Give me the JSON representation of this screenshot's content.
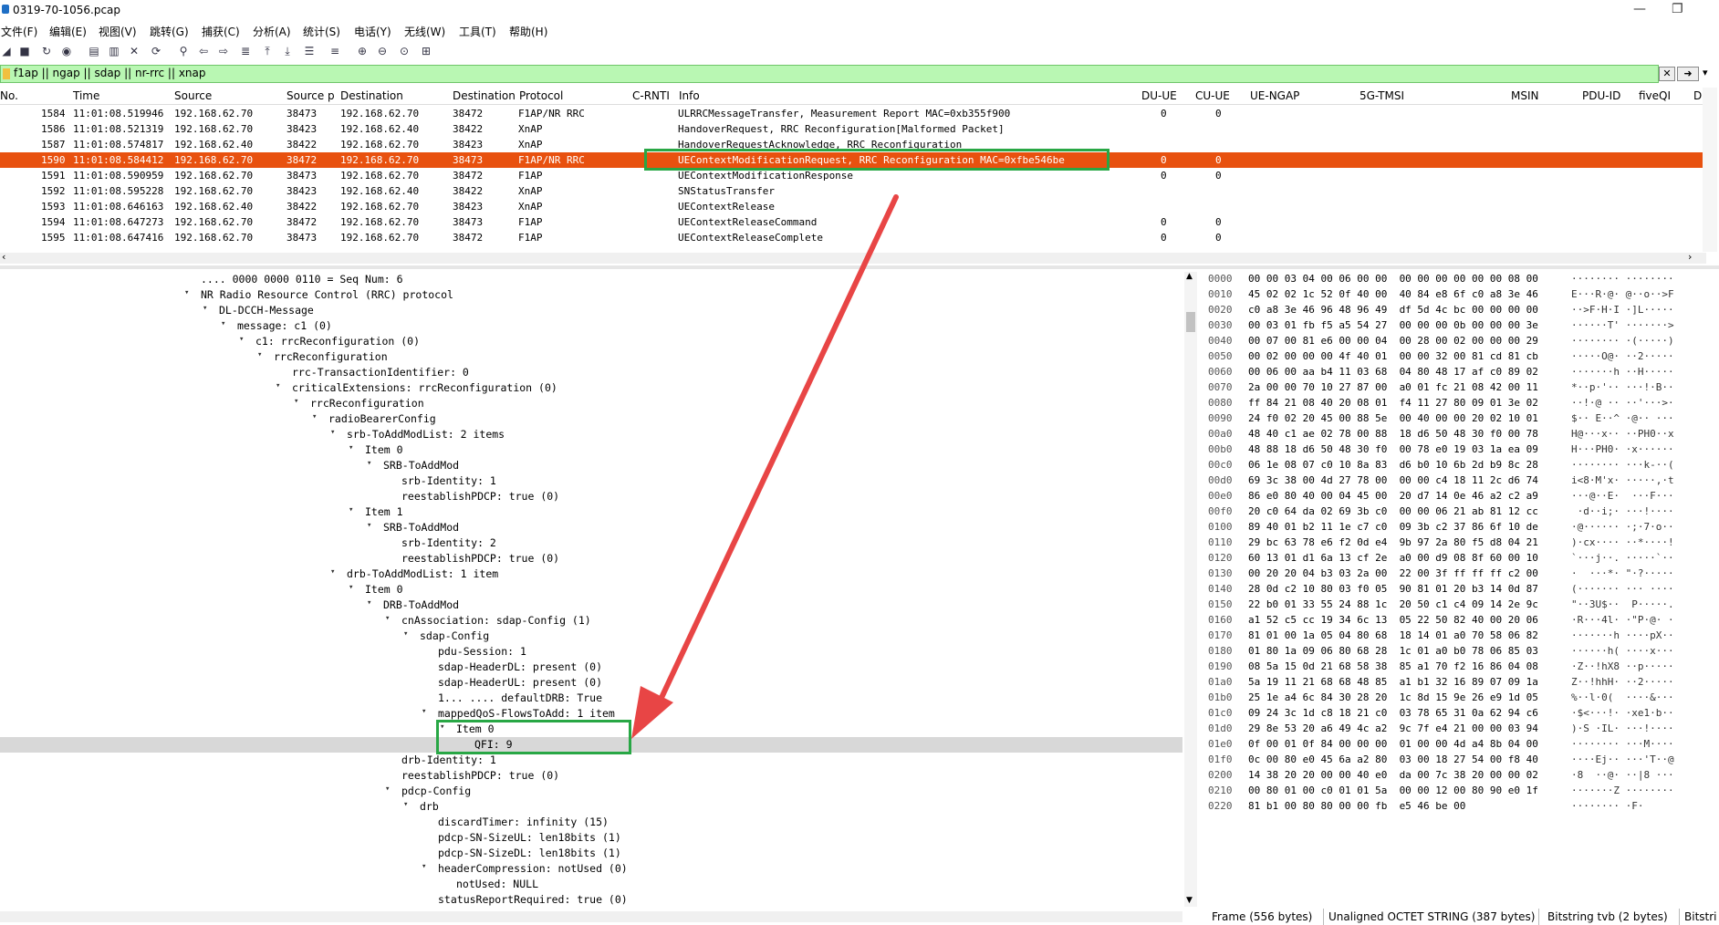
{
  "window": {
    "title": "0319-70-1056.pcap"
  },
  "menu": [
    "文件(F)",
    "编辑(E)",
    "视图(V)",
    "跳转(G)",
    "捕获(C)",
    "分析(A)",
    "统计(S)",
    "电话(Y)",
    "无线(W)",
    "工具(T)",
    "帮助(H)"
  ],
  "filter": {
    "value": "f1ap || ngap || sdap || nr-rrc || xnap"
  },
  "columns": [
    "No.",
    "Time",
    "Source",
    "Source p",
    "Destination",
    "Destination",
    "Protocol",
    "C-RNTI",
    "Info",
    "DU-UE",
    "CU-UE",
    "UE-NGAP",
    "5G-TMSI",
    "MSIN",
    "PDU-ID",
    "fiveQI",
    "D"
  ],
  "packets": [
    {
      "no": "1584",
      "time": "11:01:08.519946",
      "src": "192.168.62.70",
      "sport": "38473",
      "dst": "192.168.62.70",
      "dport": "38472",
      "proto": "F1AP/NR RRC",
      "info": "ULRRCMessageTransfer, Measurement Report MAC=0xb355f900",
      "du": "0",
      "cu": "0"
    },
    {
      "no": "1586",
      "time": "11:01:08.521319",
      "src": "192.168.62.70",
      "sport": "38423",
      "dst": "192.168.62.40",
      "dport": "38422",
      "proto": "XnAP",
      "info": "HandoverRequest, RRC Reconfiguration[Malformed Packet]",
      "du": "",
      "cu": ""
    },
    {
      "no": "1587",
      "time": "11:01:08.574817",
      "src": "192.168.62.40",
      "sport": "38422",
      "dst": "192.168.62.70",
      "dport": "38423",
      "proto": "XnAP",
      "info": "HandoverRequestAcknowledge, RRC Reconfiguration",
      "du": "",
      "cu": ""
    },
    {
      "no": "1590",
      "time": "11:01:08.584412",
      "src": "192.168.62.70",
      "sport": "38472",
      "dst": "192.168.62.70",
      "dport": "38473",
      "proto": "F1AP/NR RRC",
      "info": "UEContextModificationRequest, RRC Reconfiguration MAC=0xfbe546be",
      "du": "0",
      "cu": "0"
    },
    {
      "no": "1591",
      "time": "11:01:08.590959",
      "src": "192.168.62.70",
      "sport": "38473",
      "dst": "192.168.62.70",
      "dport": "38472",
      "proto": "F1AP",
      "info": "UEContextModificationResponse",
      "du": "0",
      "cu": "0"
    },
    {
      "no": "1592",
      "time": "11:01:08.595228",
      "src": "192.168.62.70",
      "sport": "38423",
      "dst": "192.168.62.40",
      "dport": "38422",
      "proto": "XnAP",
      "info": "SNStatusTransfer",
      "du": "",
      "cu": ""
    },
    {
      "no": "1593",
      "time": "11:01:08.646163",
      "src": "192.168.62.40",
      "sport": "38422",
      "dst": "192.168.62.70",
      "dport": "38423",
      "proto": "XnAP",
      "info": "UEContextRelease",
      "du": "",
      "cu": ""
    },
    {
      "no": "1594",
      "time": "11:01:08.647273",
      "src": "192.168.62.70",
      "sport": "38472",
      "dst": "192.168.62.70",
      "dport": "38473",
      "proto": "F1AP",
      "info": "UEContextReleaseCommand",
      "du": "0",
      "cu": "0"
    },
    {
      "no": "1595",
      "time": "11:01:08.647416",
      "src": "192.168.62.70",
      "sport": "38473",
      "dst": "192.168.62.70",
      "dport": "38472",
      "proto": "F1AP",
      "info": "UEContextReleaseComplete",
      "du": "0",
      "cu": "0"
    }
  ],
  "tree": [
    {
      "t": ".... 0000 0000 0110 = Seq Num: 6",
      "d": 11,
      "a": ""
    },
    {
      "t": "NR Radio Resource Control (RRC) protocol",
      "d": 11,
      "a": "v"
    },
    {
      "t": "DL-DCCH-Message",
      "d": 12,
      "a": "v"
    },
    {
      "t": "message: c1 (0)",
      "d": 13,
      "a": "v"
    },
    {
      "t": "c1: rrcReconfiguration (0)",
      "d": 14,
      "a": "v"
    },
    {
      "t": "rrcReconfiguration",
      "d": 15,
      "a": "v"
    },
    {
      "t": "rrc-TransactionIdentifier: 0",
      "d": 16,
      "a": ""
    },
    {
      "t": "criticalExtensions: rrcReconfiguration (0)",
      "d": 16,
      "a": "v"
    },
    {
      "t": "rrcReconfiguration",
      "d": 17,
      "a": "v"
    },
    {
      "t": "radioBearerConfig",
      "d": 18,
      "a": "v"
    },
    {
      "t": "srb-ToAddModList: 2 items",
      "d": 19,
      "a": "v"
    },
    {
      "t": "Item 0",
      "d": 20,
      "a": "v"
    },
    {
      "t": "SRB-ToAddMod",
      "d": 21,
      "a": "v"
    },
    {
      "t": "srb-Identity: 1",
      "d": 22,
      "a": ""
    },
    {
      "t": "reestablishPDCP: true (0)",
      "d": 22,
      "a": ""
    },
    {
      "t": "Item 1",
      "d": 20,
      "a": "v"
    },
    {
      "t": "SRB-ToAddMod",
      "d": 21,
      "a": "v"
    },
    {
      "t": "srb-Identity: 2",
      "d": 22,
      "a": ""
    },
    {
      "t": "reestablishPDCP: true (0)",
      "d": 22,
      "a": ""
    },
    {
      "t": "drb-ToAddModList: 1 item",
      "d": 19,
      "a": "v"
    },
    {
      "t": "Item 0",
      "d": 20,
      "a": "v"
    },
    {
      "t": "DRB-ToAddMod",
      "d": 21,
      "a": "v"
    },
    {
      "t": "cnAssociation: sdap-Config (1)",
      "d": 22,
      "a": "v"
    },
    {
      "t": "sdap-Config",
      "d": 23,
      "a": "v"
    },
    {
      "t": "pdu-Session: 1",
      "d": 24,
      "a": ""
    },
    {
      "t": "sdap-HeaderDL: present (0)",
      "d": 24,
      "a": ""
    },
    {
      "t": "sdap-HeaderUL: present (0)",
      "d": 24,
      "a": ""
    },
    {
      "t": "1... .... defaultDRB: True",
      "d": 24,
      "a": ""
    },
    {
      "t": "mappedQoS-FlowsToAdd: 1 item",
      "d": 24,
      "a": "v"
    },
    {
      "t": "Item 0",
      "d": 25,
      "a": "v"
    },
    {
      "t": "QFI: 9",
      "d": 26,
      "a": "",
      "hl": true
    },
    {
      "t": "drb-Identity: 1",
      "d": 22,
      "a": ""
    },
    {
      "t": "reestablishPDCP: true (0)",
      "d": 22,
      "a": ""
    },
    {
      "t": "pdcp-Config",
      "d": 22,
      "a": "v"
    },
    {
      "t": "drb",
      "d": 23,
      "a": "v"
    },
    {
      "t": "discardTimer: infinity (15)",
      "d": 24,
      "a": ""
    },
    {
      "t": "pdcp-SN-SizeUL: len18bits (1)",
      "d": 24,
      "a": ""
    },
    {
      "t": "pdcp-SN-SizeDL: len18bits (1)",
      "d": 24,
      "a": ""
    },
    {
      "t": "headerCompression: notUsed (0)",
      "d": 24,
      "a": "v"
    },
    {
      "t": "notUsed: NULL",
      "d": 25,
      "a": ""
    },
    {
      "t": "statusReportRequired: true (0)",
      "d": 24,
      "a": ""
    }
  ],
  "hex": [
    {
      "o": "0000",
      "h": "00 00 03 04 00 06 00 00  00 00 00 00 00 00 08 00",
      "a": "········ ········"
    },
    {
      "o": "0010",
      "h": "45 02 02 1c 52 0f 40 00  40 84 e8 6f c0 a8 3e 46",
      "a": "E···R·@· @··o··>F"
    },
    {
      "o": "0020",
      "h": "c0 a8 3e 46 96 48 96 49  df 5d 4c bc 00 00 00 00",
      "a": "··>F·H·I ·]L·····"
    },
    {
      "o": "0030",
      "h": "00 03 01 fb f5 a5 54 27  00 00 00 0b 00 00 00 3e",
      "a": "······T' ·······>"
    },
    {
      "o": "0040",
      "h": "00 07 00 81 e6 00 00 04  00 28 00 02 00 00 00 29",
      "a": "········ ·(·····)"
    },
    {
      "o": "0050",
      "h": "00 02 00 00 00 4f 40 01  00 00 32 00 81 cd 81 cb",
      "a": "·····O@· ··2·····"
    },
    {
      "o": "0060",
      "h": "00 06 00 aa b4 11 03 68  04 80 48 17 af c0 89 02",
      "a": "·······h ··H·····"
    },
    {
      "o": "0070",
      "h": "2a 00 00 70 10 27 87 00  a0 01 fc 21 08 42 00 11",
      "a": "*··p·'·· ···!·B··"
    },
    {
      "o": "0080",
      "h": "ff 84 21 08 40 20 08 01  f4 11 27 80 09 01 3e 02",
      "a": "··!·@ ·· ··'···>·"
    },
    {
      "o": "0090",
      "h": "24 f0 02 20 45 00 88 5e  00 40 00 00 20 02 10 01",
      "a": "$·· E··^ ·@·· ···"
    },
    {
      "o": "00a0",
      "h": "48 40 c1 ae 02 78 00 88  18 d6 50 48 30 f0 00 78",
      "a": "H@···x·· ··PH0··x"
    },
    {
      "o": "00b0",
      "h": "48 88 18 d6 50 48 30 f0  00 78 e0 19 03 1a ea 09",
      "a": "H···PH0· ·x······"
    },
    {
      "o": "00c0",
      "h": "06 1e 08 07 c0 10 8a 83  d6 b0 10 6b 2d b9 8c 28",
      "a": "········ ···k-··("
    },
    {
      "o": "00d0",
      "h": "69 3c 38 00 4d 27 78 00  00 00 c4 18 11 2c d6 74",
      "a": "i<8·M'x· ·····,·t"
    },
    {
      "o": "00e0",
      "h": "86 e0 80 40 00 04 45 00  20 d7 14 0e 46 a2 c2 a9",
      "a": "···@··E·  ···F···"
    },
    {
      "o": "00f0",
      "h": "20 c0 64 da 02 69 3b c0  00 00 06 21 ab 81 12 cc",
      "a": " ·d··i;· ···!····"
    },
    {
      "o": "0100",
      "h": "89 40 01 b2 11 1e c7 c0  09 3b c2 37 86 6f 10 de",
      "a": "·@······ ·;·7·o··"
    },
    {
      "o": "0110",
      "h": "29 bc 63 78 e6 f2 0d e4  9b 97 2a 80 f5 d8 04 21",
      "a": ")·cx···· ··*····!"
    },
    {
      "o": "0120",
      "h": "60 13 01 d1 6a 13 cf 2e  a0 00 d9 08 8f 60 00 10",
      "a": "`···j··. ·····`··"
    },
    {
      "o": "0130",
      "h": "00 20 20 04 b3 03 2a 00  22 00 3f ff ff ff c2 00",
      "a": "·  ···*· \"·?·····"
    },
    {
      "o": "0140",
      "h": "28 0d c2 10 80 03 f0 05  90 81 01 20 b3 14 0d 87",
      "a": "(······· ··· ····"
    },
    {
      "o": "0150",
      "h": "22 b0 01 33 55 24 88 1c  20 50 c1 c4 09 14 2e 9c",
      "a": "\"··3U$··  P·····."
    },
    {
      "o": "0160",
      "h": "a1 52 c5 cc 19 34 6c 13  05 22 50 82 40 00 20 06",
      "a": "·R···4l· ·\"P·@· ·"
    },
    {
      "o": "0170",
      "h": "81 01 00 1a 05 04 80 68  18 14 01 a0 70 58 06 82",
      "a": "·······h ····pX··"
    },
    {
      "o": "0180",
      "h": "01 80 1a 09 06 80 68 28  1c 01 a0 b0 78 06 85 03",
      "a": "······h( ····x···"
    },
    {
      "o": "0190",
      "h": "08 5a 15 0d 21 68 58 38  85 a1 70 f2 16 86 04 08",
      "a": "·Z··!hX8 ··p·····"
    },
    {
      "o": "01a0",
      "h": "5a 19 11 21 68 68 48 85  a1 b1 32 16 89 07 09 1a",
      "a": "Z··!hhH· ··2·····"
    },
    {
      "o": "01b0",
      "h": "25 1e a4 6c 84 30 28 20  1c 8d 15 9e 26 e9 1d 05",
      "a": "%··l·0(  ····&···"
    },
    {
      "o": "01c0",
      "h": "09 24 3c 1d c8 18 21 c0  03 78 65 31 0a 62 94 c6",
      "a": "·$<···!· ·xe1·b··"
    },
    {
      "o": "01d0",
      "h": "29 8e 53 20 a6 49 4c a2  9c 7f e4 21 00 00 03 94",
      "a": ")·S ·IL· ···!····"
    },
    {
      "o": "01e0",
      "h": "0f 00 01 0f 84 00 00 00  01 00 00 4d a4 8b 04 00",
      "a": "········ ···M····"
    },
    {
      "o": "01f0",
      "h": "0c 00 80 e0 45 6a a2 80  03 00 18 27 54 00 f8 40",
      "a": "····Ej·· ···'T··@"
    },
    {
      "o": "0200",
      "h": "14 38 20 20 00 00 40 e0  da 00 7c 38 20 00 00 02",
      "a": "·8  ··@· ··|8 ···"
    },
    {
      "o": "0210",
      "h": "00 80 01 00 c0 01 01 5a  00 00 12 00 80 90 e0 1f",
      "a": "·······Z ········"
    },
    {
      "o": "0220",
      "h": "81 b1 00 80 80 00 00 fb  e5 46 be 00",
      "a": "········ ·F·"
    }
  ],
  "status": {
    "frame": "Frame (556 bytes)",
    "unaligned": "Unaligned OCTET STRING (387 bytes)",
    "bitstring": "Bitstring tvb (2 bytes)",
    "bitstr": "Bitstri"
  },
  "colors": {
    "selected_row": "#e8510f",
    "filter_bg": "#b9f7b3",
    "annotation_box": "#28a745",
    "arrow": "#e84545"
  }
}
